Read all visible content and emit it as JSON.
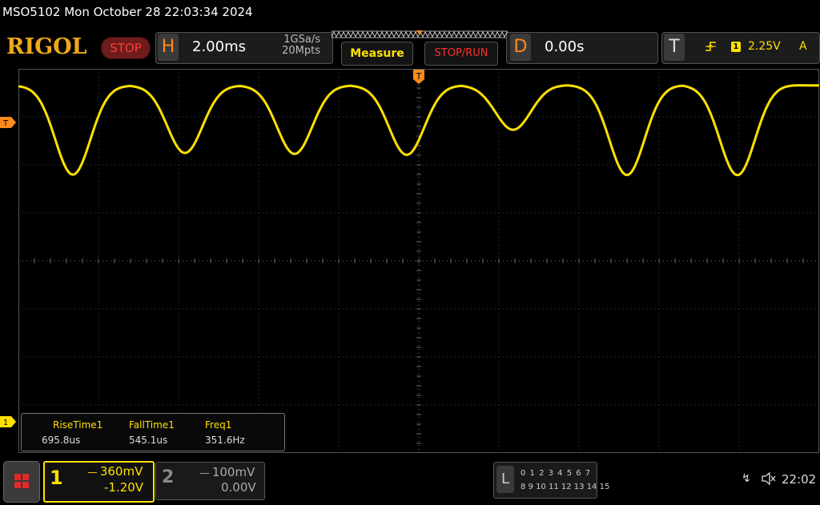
{
  "title_bar": {
    "text": "MSO5102  Mon October 28 22:03:34 2024"
  },
  "top_bar": {
    "logo": "RIGOL",
    "run_state": "STOP",
    "horizontal": {
      "letter": "H",
      "timebase": "2.00ms",
      "sample_rate": "1GSa/s",
      "memory_depth": "20Mpts"
    },
    "measure_label": "Measure",
    "stop_run_label": "STOP/RUN",
    "delay": {
      "letter": "D",
      "value": "0.00s"
    },
    "trigger": {
      "letter": "T",
      "edge_icon": "rising-edge-icon",
      "source": "1",
      "level": "2.25V",
      "mode": "A"
    }
  },
  "markers": {
    "trigger_top": "T",
    "trigger_left": "T",
    "ch1_ground": "1"
  },
  "measurements": [
    {
      "name": "RiseTime1",
      "value": "695.8us"
    },
    {
      "name": "FallTime1",
      "value": "545.1us"
    },
    {
      "name": "Freq1",
      "value": "351.6Hz"
    }
  ],
  "channels": {
    "ch1": {
      "number": "1",
      "scale": "360mV",
      "offset": "-1.20V",
      "coupling_icon": "dc-coupling-icon"
    },
    "ch2": {
      "number": "2",
      "scale": "100mV",
      "offset": "0.00V",
      "coupling_icon": "dc-coupling-icon"
    }
  },
  "logic_analyzer": {
    "letter": "L",
    "row1": "0 1 2 3  4 5 6 7",
    "row2": "8 9 10 11 12 13 14 15"
  },
  "status": {
    "usb_icon": "usb-icon",
    "speaker_icon": "speaker-muted-icon",
    "time": "22:02"
  },
  "colors": {
    "ch1": "#ffe100",
    "accent": "#ff8a1c",
    "grid": "#3a3a3a",
    "stop": "#ff3a3a"
  },
  "waveform": {
    "channel": "1",
    "minima": [
      {
        "t_div": 0.68,
        "depth": 1.0
      },
      {
        "t_div": 2.08,
        "depth": 0.76
      },
      {
        "t_div": 3.45,
        "depth": 0.77
      },
      {
        "t_div": 4.85,
        "depth": 0.78
      },
      {
        "t_div": 6.18,
        "depth": 0.5
      },
      {
        "t_div": 7.6,
        "depth": 1.0
      },
      {
        "t_div": 8.98,
        "depth": 1.0
      }
    ]
  }
}
